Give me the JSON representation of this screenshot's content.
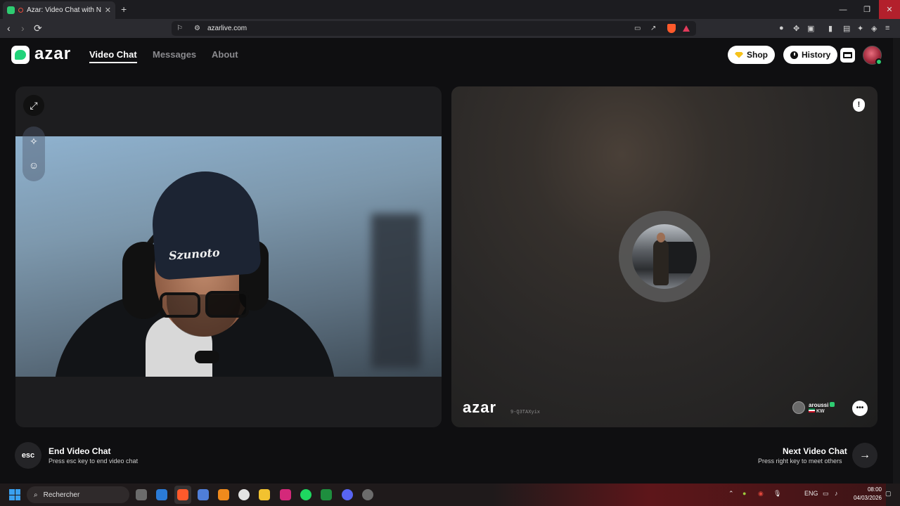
{
  "browser": {
    "tab_title": "Azar: Video Chat with New Pe",
    "tab_close": "✕",
    "new_tab": "+",
    "url": "azarlive.com",
    "window_controls": {
      "minimize": "—",
      "restore": "❐",
      "close": "✕"
    }
  },
  "header": {
    "logo_text": "azar",
    "nav": [
      {
        "label": "Video Chat",
        "active": true
      },
      {
        "label": "Messages",
        "active": false
      },
      {
        "label": "About",
        "active": false
      }
    ],
    "shop_label": "Shop",
    "history_label": "History"
  },
  "self_view": {
    "beanie_text": "Szunoto"
  },
  "peer": {
    "watermark": "azar",
    "watermark_id": "9-Q3TAXyix",
    "name": "aroussi",
    "country": "KW",
    "report_icon": "!"
  },
  "controls": {
    "esc_label": "esc",
    "end_title": "End Video Chat",
    "end_sub": "Press esc key to end video chat",
    "next_title": "Next Video Chat",
    "next_sub": "Press right key to meet others",
    "next_icon": "→"
  },
  "taskbar": {
    "search_placeholder": "Rechercher",
    "lang": "ENG",
    "time": "08:00",
    "date": "04/03/2026"
  },
  "colors": {
    "accent_green": "#21d37a",
    "shop_gem": "#f6c21b",
    "background": "#0f0f11"
  }
}
